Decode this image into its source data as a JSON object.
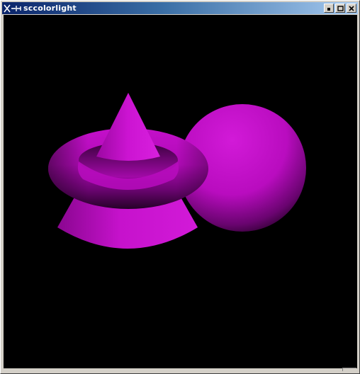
{
  "window": {
    "title": "sccolorlight",
    "controls": [
      {
        "name": "minimize-button",
        "icon": "minimize-icon"
      },
      {
        "name": "maximize-button",
        "icon": "maximize-icon"
      },
      {
        "name": "close-button",
        "icon": "close-icon"
      }
    ]
  },
  "scene": {
    "background_color": "#000000",
    "object_color": "#c010c8",
    "objects": [
      "torus",
      "cone",
      "sphere"
    ]
  }
}
